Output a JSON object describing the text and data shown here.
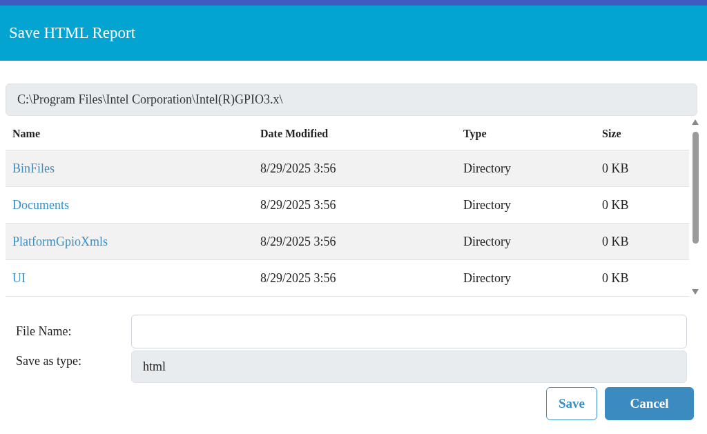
{
  "window": {
    "title": "Save HTML Report"
  },
  "path": "C:\\Program Files\\Intel Corporation\\Intel(R)GPIO3.x\\",
  "table": {
    "columns": [
      "Name",
      "Date Modified",
      "Type",
      "Size"
    ],
    "rows": [
      {
        "name": "BinFiles",
        "date": "8/29/2025 3:56",
        "type": "Directory",
        "size": "0 KB"
      },
      {
        "name": "Documents",
        "date": "8/29/2025 3:56",
        "type": "Directory",
        "size": "0 KB"
      },
      {
        "name": "PlatformGpioXmls",
        "date": "8/29/2025 3:56",
        "type": "Directory",
        "size": "0 KB"
      },
      {
        "name": "UI",
        "date": "8/29/2025 3:56",
        "type": "Directory",
        "size": "0 KB"
      }
    ]
  },
  "file_name": {
    "label": "File Name:"
  },
  "save_as_type": {
    "label": "Save as type:",
    "value": "html"
  },
  "buttons": [
    {
      "label": "Save",
      "kind": "secondary"
    },
    {
      "label": "Cancel",
      "kind": "primary"
    }
  ]
}
